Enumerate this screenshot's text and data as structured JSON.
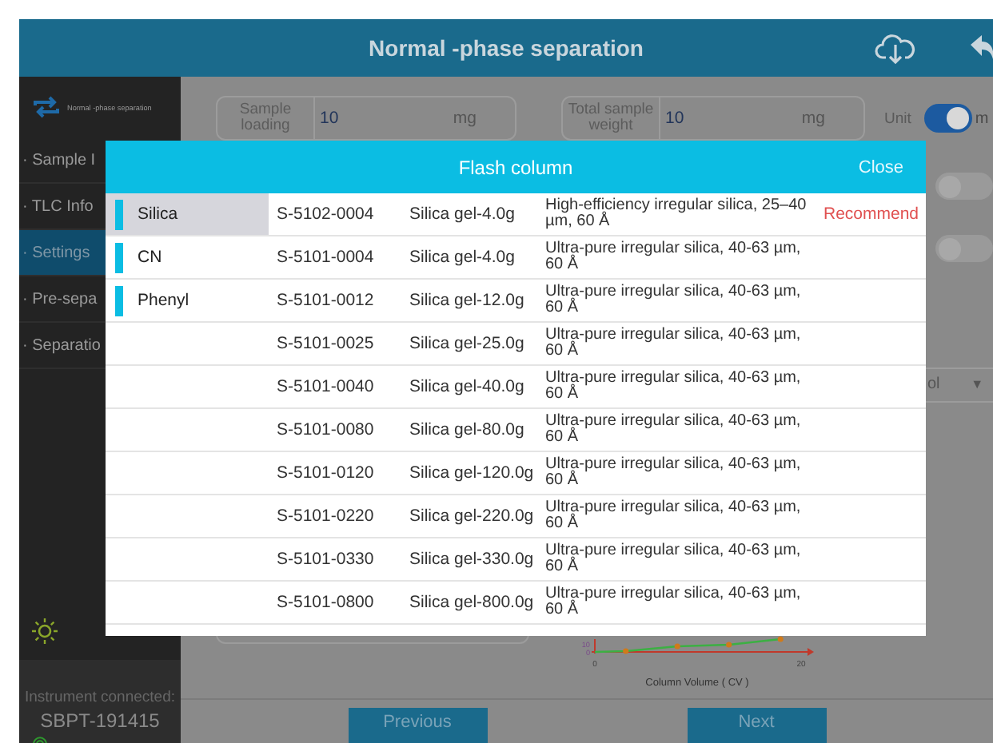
{
  "header": {
    "title": "Normal -phase separation"
  },
  "sidebar": {
    "title": "Normal -phase separation",
    "items": [
      {
        "label": "· Sample I",
        "selected": false
      },
      {
        "label": "· TLC Info",
        "selected": false
      },
      {
        "label": "· Settings",
        "selected": true
      },
      {
        "label": "· Pre-sepa",
        "selected": false
      },
      {
        "label": "· Separatio",
        "selected": false
      }
    ],
    "instrument_label": "Instrument connected:",
    "instrument_id": "SBPT-191415"
  },
  "form": {
    "fields": [
      {
        "label": "Sample loading",
        "value": "10",
        "unit": "mg"
      },
      {
        "label": "Total sample weight",
        "value": "10",
        "unit": "mg"
      }
    ],
    "unit_label": "Unit",
    "unit_toggle": {
      "on": true,
      "label": "m"
    },
    "toggles": [
      {
        "on": false
      },
      {
        "on": false
      }
    ],
    "dropdown": {
      "value": "ol",
      "arrow": "▼"
    },
    "chart_data": {
      "type": "line",
      "xlabel": "Column Volume ( CV )",
      "x": [
        0,
        3,
        8,
        13,
        18
      ],
      "series": [
        {
          "color": "#3cb043",
          "marker": true,
          "values": [
            0,
            1,
            7,
            9,
            16
          ]
        }
      ],
      "xlim": [
        0,
        20
      ],
      "xticks": [
        0,
        20
      ],
      "ylim": [
        0,
        16
      ],
      "yticks": [
        0,
        10
      ]
    }
  },
  "buttons": [
    "Previous",
    "Next"
  ],
  "modal": {
    "title": "Flash column",
    "close": "Close",
    "categories": [
      {
        "label": "Silica",
        "selected": true
      },
      {
        "label": "CN",
        "selected": false
      },
      {
        "label": "Phenyl",
        "selected": false
      }
    ],
    "rows": [
      {
        "code": "S-5102-0004",
        "name": "Silica gel-4.0g",
        "description": "High-efficiency irregular silica, 25–40 µm, 60 Å",
        "tag": "Recommend"
      },
      {
        "code": "S-5101-0004",
        "name": "Silica gel-4.0g",
        "description": "Ultra-pure irregular silica, 40-63 µm, 60 Å"
      },
      {
        "code": "S-5101-0012",
        "name": "Silica gel-12.0g",
        "description": "Ultra-pure irregular silica, 40-63 µm, 60 Å"
      },
      {
        "code": "S-5101-0025",
        "name": "Silica gel-25.0g",
        "description": "Ultra-pure irregular silica, 40-63 µm, 60 Å"
      },
      {
        "code": "S-5101-0040",
        "name": "Silica gel-40.0g",
        "description": "Ultra-pure irregular silica, 40-63 µm, 60 Å"
      },
      {
        "code": "S-5101-0080",
        "name": "Silica gel-80.0g",
        "description": "Ultra-pure irregular silica, 40-63 µm, 60 Å"
      },
      {
        "code": "S-5101-0120",
        "name": "Silica gel-120.0g",
        "description": "Ultra-pure irregular silica, 40-63 µm, 60 Å"
      },
      {
        "code": "S-5101-0220",
        "name": "Silica gel-220.0g",
        "description": "Ultra-pure irregular silica, 40-63 µm, 60 Å"
      },
      {
        "code": "S-5101-0330",
        "name": "Silica gel-330.0g",
        "description": "Ultra-pure irregular silica, 40-63 µm, 60 Å"
      },
      {
        "code": "S-5101-0800",
        "name": "Silica gel-800.0g",
        "description": "Ultra-pure irregular silica, 40-63 µm, 60 Å"
      }
    ]
  }
}
